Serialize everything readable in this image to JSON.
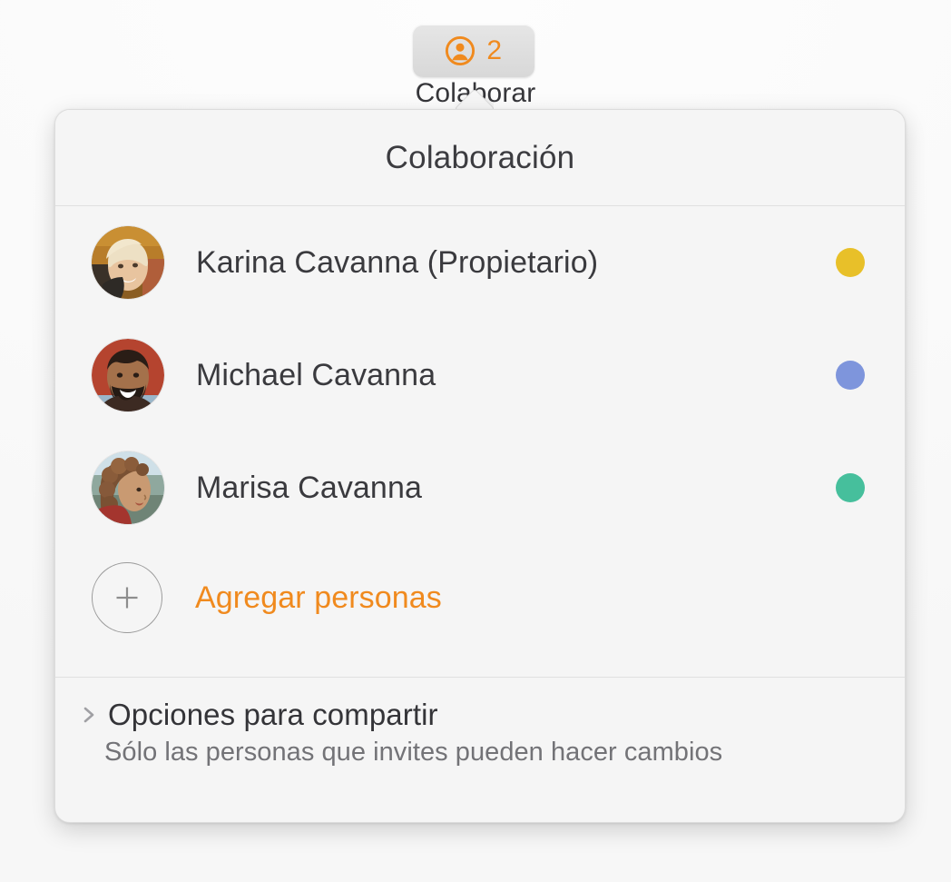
{
  "toolbar": {
    "collaborate_button": {
      "icon": "person-circle-icon",
      "count": "2",
      "label": "Colaborar",
      "accent_color": "#f08a1e"
    }
  },
  "popover": {
    "title": "Colaboración",
    "people": [
      {
        "name": "Karina Cavanna (Propietario)",
        "avatar": "photo-woman-blonde",
        "status_color": "#e8c029"
      },
      {
        "name": "Michael Cavanna",
        "avatar": "photo-man-beard",
        "status_color": "#7e95dc"
      },
      {
        "name": "Marisa Cavanna",
        "avatar": "photo-woman-curly",
        "status_color": "#46bf9c"
      }
    ],
    "add_people": {
      "icon": "plus-icon",
      "label": "Agregar personas",
      "accent_color": "#f08a1e"
    },
    "footer": {
      "chevron": "chevron-right-icon",
      "share_options_label": "Opciones para compartir",
      "share_note": "Sólo las personas que invites pueden hacer cambios"
    }
  }
}
